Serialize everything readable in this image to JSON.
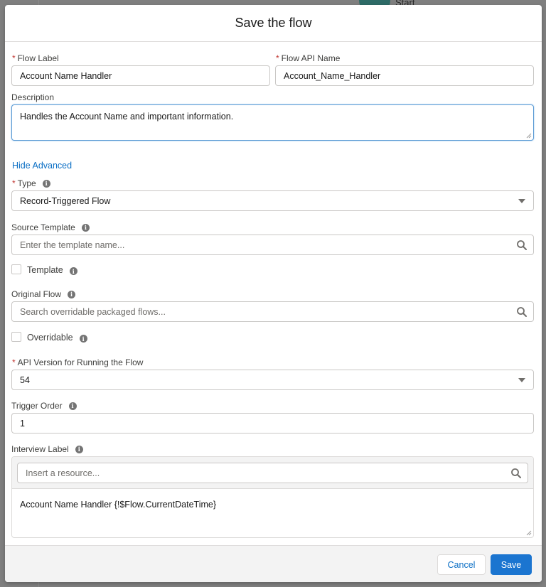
{
  "background": {
    "start_node_label": "Start"
  },
  "modal": {
    "title": "Save the flow",
    "fields": {
      "flow_label": {
        "label": "Flow Label",
        "required": true,
        "value": "Account Name Handler"
      },
      "flow_api_name": {
        "label": "Flow API Name",
        "required": true,
        "value": "Account_Name_Handler"
      },
      "description": {
        "label": "Description",
        "value": "Handles the Account Name and important information."
      },
      "hide_advanced_link": "Hide Advanced",
      "type": {
        "label": "Type",
        "required": true,
        "value": "Record-Triggered Flow",
        "icon": "info-icon"
      },
      "source_template": {
        "label": "Source Template",
        "placeholder": "Enter the template name...",
        "icon": "search-icon"
      },
      "template_checkbox": {
        "label": "Template",
        "checked": false
      },
      "original_flow": {
        "label": "Original Flow",
        "placeholder": "Search overridable packaged flows...",
        "icon": "search-icon"
      },
      "overridable_checkbox": {
        "label": "Overridable",
        "checked": false
      },
      "api_version": {
        "label": "API Version for Running the Flow",
        "required": true,
        "value": "54"
      },
      "trigger_order": {
        "label": "Trigger Order",
        "value": "1"
      },
      "interview_label": {
        "label": "Interview Label",
        "resource_placeholder": "Insert a resource...",
        "value": "Account Name Handler {!$Flow.CurrentDateTime}"
      }
    },
    "required_marker": "*",
    "info_glyph": "i",
    "footer": {
      "cancel_label": "Cancel",
      "save_label": "Save"
    }
  },
  "colors": {
    "accent": "#1b75d0",
    "link": "#0b6fc5",
    "required": "#c23934",
    "overlay": "#7f7f7f"
  }
}
